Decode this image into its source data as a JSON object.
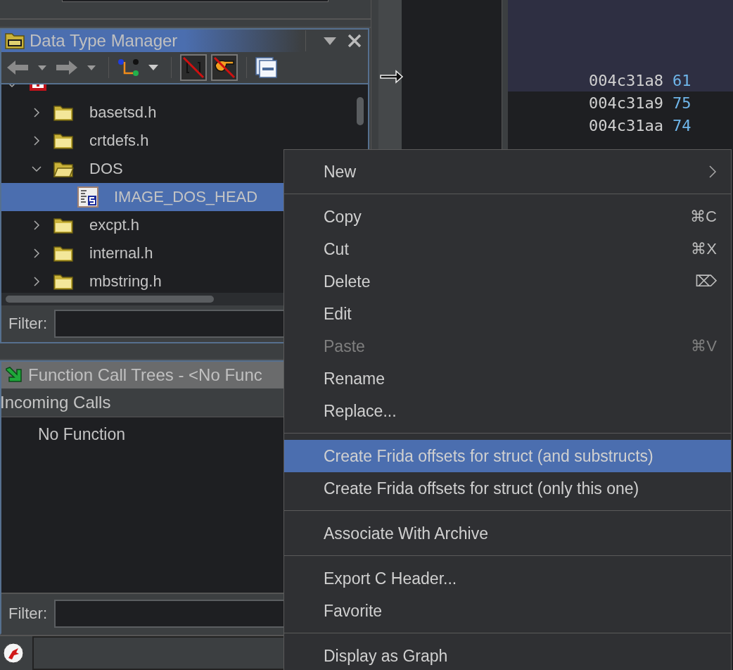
{
  "data_type_manager": {
    "title": "Data Type Manager",
    "toolbar": [
      {
        "kind": "back"
      },
      {
        "kind": "forward"
      },
      {
        "kind": "merge"
      },
      {
        "kind": "toggle-array",
        "pressed": true
      },
      {
        "kind": "toggle-pointer",
        "pressed": true
      },
      {
        "kind": "collapse"
      }
    ],
    "tree": [
      {
        "kind": "program",
        "expanded": true,
        "selected": false,
        "children": [
          {
            "label": "basetsd.h",
            "kind": "folder",
            "expanded": false,
            "selected": false
          },
          {
            "label": "crtdefs.h",
            "kind": "folder",
            "expanded": false,
            "selected": false
          },
          {
            "label": "DOS",
            "kind": "folder",
            "expanded": true,
            "selected": false,
            "children": [
              {
                "label": "IMAGE_DOS_HEAD",
                "kind": "struct",
                "selected": true
              }
            ]
          },
          {
            "label": "excpt.h",
            "kind": "folder",
            "expanded": false,
            "selected": false
          },
          {
            "label": "internal.h",
            "kind": "folder",
            "expanded": false,
            "selected": false
          },
          {
            "label": "mbstring.h",
            "kind": "folder",
            "expanded": false,
            "selected": false
          }
        ]
      }
    ],
    "filter": {
      "label": "Filter:"
    }
  },
  "function_call_trees": {
    "title": "Function Call Trees - <No Func",
    "section": "Incoming Calls",
    "rows": [
      "No Function"
    ],
    "filter": {
      "label": "Filter:"
    }
  },
  "listing": {
    "rows": [
      {
        "address": "004c31a8",
        "value": "61",
        "selected": true
      },
      {
        "address": "004c31a9",
        "value": "75",
        "selected": false
      },
      {
        "address": "004c31aa",
        "value": "74",
        "selected": false
      }
    ]
  },
  "context_menu": {
    "items": [
      {
        "kind": "item",
        "label": "New",
        "submenu": true,
        "disabled": false,
        "selected": false
      },
      {
        "kind": "separator"
      },
      {
        "kind": "item",
        "label": "Copy",
        "shortcut": "⌘C",
        "disabled": false,
        "selected": false
      },
      {
        "kind": "item",
        "label": "Cut",
        "shortcut": "⌘X",
        "disabled": false,
        "selected": false
      },
      {
        "kind": "item",
        "label": "Delete",
        "shortcut": "⌦",
        "disabled": false,
        "selected": false
      },
      {
        "kind": "item",
        "label": "Edit",
        "disabled": false,
        "selected": false
      },
      {
        "kind": "item",
        "label": "Paste",
        "shortcut": "⌘V",
        "disabled": true,
        "selected": false
      },
      {
        "kind": "item",
        "label": "Rename",
        "disabled": false,
        "selected": false
      },
      {
        "kind": "item",
        "label": "Replace...",
        "disabled": false,
        "selected": false
      },
      {
        "kind": "separator"
      },
      {
        "kind": "item",
        "label": "Create Frida offsets for struct (and substructs)",
        "disabled": false,
        "selected": true
      },
      {
        "kind": "item",
        "label": "Create Frida offsets for struct (only this one)",
        "disabled": false,
        "selected": false
      },
      {
        "kind": "separator"
      },
      {
        "kind": "item",
        "label": "Associate With Archive",
        "disabled": false,
        "selected": false
      },
      {
        "kind": "separator"
      },
      {
        "kind": "item",
        "label": "Export C Header...",
        "disabled": false,
        "selected": false
      },
      {
        "kind": "item",
        "label": "Favorite",
        "disabled": false,
        "selected": false
      },
      {
        "kind": "separator"
      },
      {
        "kind": "item",
        "label": "Display as Graph",
        "disabled": false,
        "selected": false
      }
    ]
  }
}
